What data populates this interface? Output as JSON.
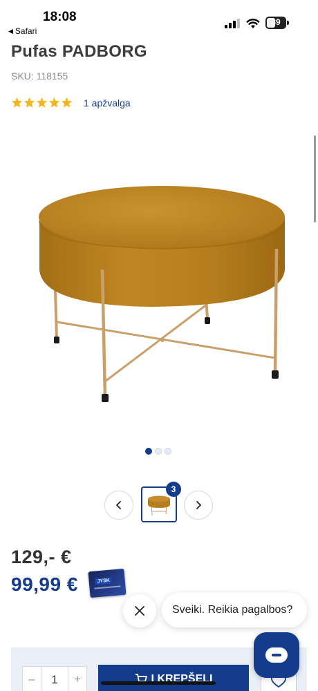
{
  "status_bar": {
    "time": "18:08",
    "back_label": "Safari",
    "battery": "39"
  },
  "product": {
    "title": "Pufas PADBORG",
    "sku": "SKU: 118155",
    "rating_stars": 5,
    "reviews_link": "1 apžvalga",
    "image_alt": "Pufas PADBORG",
    "gallery_count": 3,
    "gallery_index": 1,
    "thumbnail_badge": "3"
  },
  "prices": {
    "old": "129,-  €",
    "new": "99,99 €",
    "card_logo": "JYSK"
  },
  "chat": {
    "greeting": "Sveiki. Reikia pagalbos?"
  },
  "purchase": {
    "minus": "–",
    "quantity": "1",
    "plus": "+",
    "add_to_cart": "Į KREPŠELĮ"
  },
  "colors": {
    "accent": "#143c8c",
    "star": "#f6b51a",
    "upholstery": "#b57d1e",
    "legs": "#c9a06a"
  }
}
